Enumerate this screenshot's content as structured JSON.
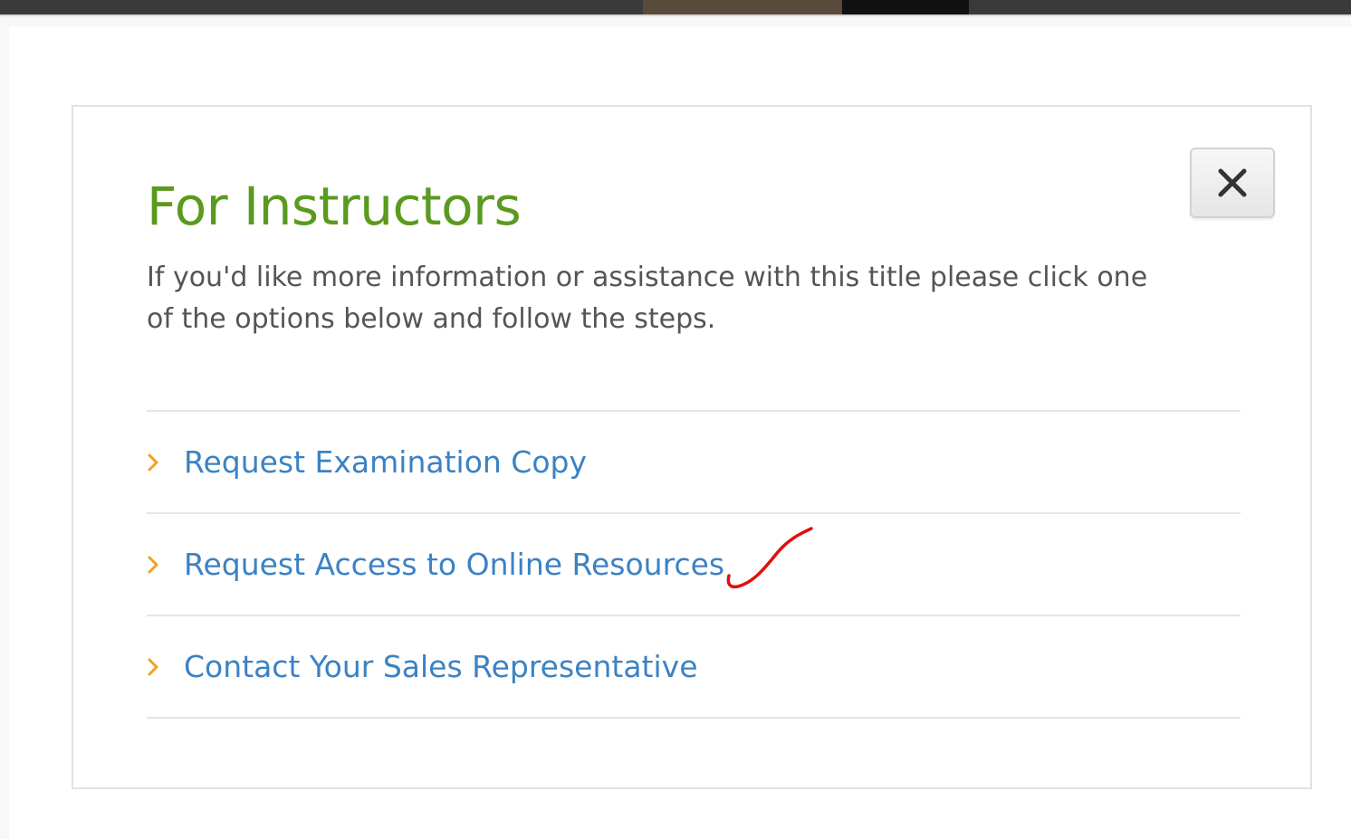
{
  "modal": {
    "title": "For Instructors",
    "intro": "If you'd like more information or assistance with this title please click one of the options below and follow the steps.",
    "close_icon": "close-x-icon",
    "options": [
      {
        "label": "Request Examination Copy",
        "icon": "chevron-right-icon"
      },
      {
        "label": "Request Access to Online Resources",
        "icon": "chevron-right-icon"
      },
      {
        "label": "Contact Your Sales Representative",
        "icon": "chevron-right-icon"
      }
    ]
  },
  "annotation": {
    "icon": "red-checkmark-icon"
  },
  "colors": {
    "title": "#5a9a1e",
    "link": "#3b82c4",
    "chevron": "#f0a020",
    "annotation": "#e01010",
    "text": "#555555"
  }
}
